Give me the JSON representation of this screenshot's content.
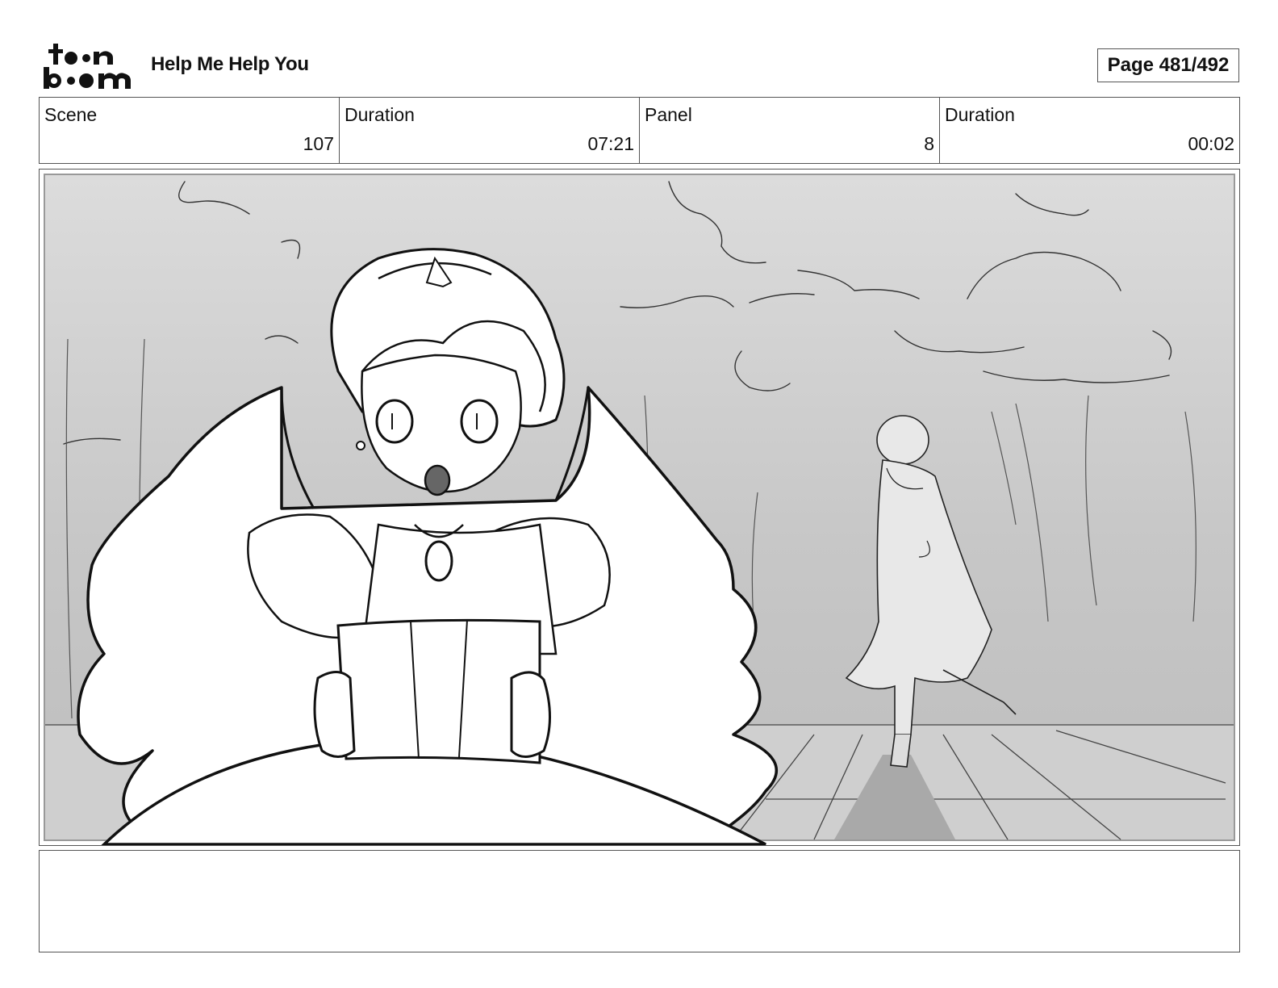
{
  "header": {
    "logo_top": "to•n",
    "logo_bottom": "b••m",
    "title": "Help Me Help You",
    "page": "Page 481/492"
  },
  "info": {
    "scene_label": "Scene",
    "scene_value": "107",
    "scene_duration_label": "Duration",
    "scene_duration_value": "07:21",
    "panel_label": "Panel",
    "panel_value": "8",
    "panel_duration_label": "Duration",
    "panel_duration_value": "00:02"
  },
  "notes": {
    "text": ""
  }
}
